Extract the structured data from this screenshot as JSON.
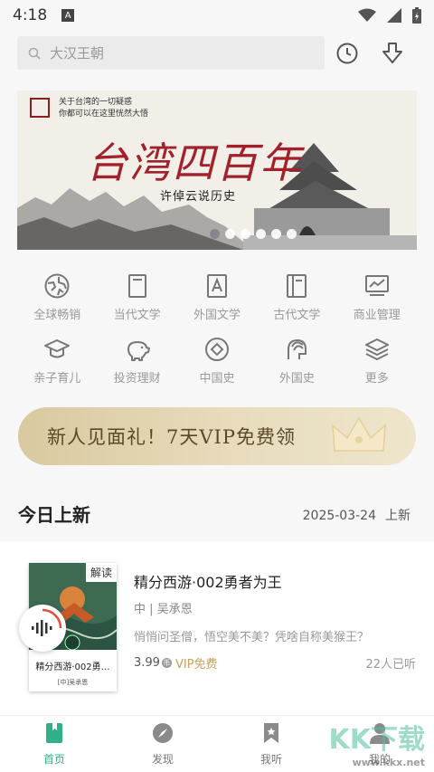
{
  "status_bar": {
    "time": "4:18",
    "sim_label": "A"
  },
  "search": {
    "placeholder": "大汉王朝"
  },
  "banner": {
    "line1": "关于台湾的一切疑惑",
    "line2": "你都可以在这里恍然大悟",
    "title": "台湾四百年",
    "subtitle": "许倬云说历史",
    "dot_count": 6,
    "active_dot": 0
  },
  "categories": [
    {
      "label": "全球畅销",
      "icon": "globe-icon"
    },
    {
      "label": "当代文学",
      "icon": "book-icon"
    },
    {
      "label": "外国文学",
      "icon": "letter-a-book-icon"
    },
    {
      "label": "古代文学",
      "icon": "scroll-book-icon"
    },
    {
      "label": "商业管理",
      "icon": "chart-monitor-icon"
    },
    {
      "label": "亲子育儿",
      "icon": "graduation-cap-icon"
    },
    {
      "label": "投资理财",
      "icon": "piggy-bank-icon"
    },
    {
      "label": "中国史",
      "icon": "ancient-coin-icon"
    },
    {
      "label": "外国史",
      "icon": "spartan-helmet-icon"
    },
    {
      "label": "更多",
      "icon": "layers-icon"
    }
  ],
  "vip_banner": {
    "text": "新人见面礼！7天VIP免费领"
  },
  "section": {
    "title": "今日上新",
    "date": "2025-03-24",
    "suffix": "上新"
  },
  "book": {
    "cover_tag": "解读",
    "cover_title": "精分西游·002勇…",
    "cover_author": "[中]吴承恩",
    "title": "精分西游·002勇者为王",
    "author": "中 | 吴承恩",
    "description": "悄悄问圣僧，悟空美不美？凭啥自称美猴王？",
    "price": "3.99",
    "coin_symbol": "币",
    "vip_label": "VIP免费",
    "listeners": "22人已听"
  },
  "nav": [
    {
      "label": "首页",
      "icon": "home-book-icon",
      "active": true
    },
    {
      "label": "发现",
      "icon": "compass-icon",
      "active": false
    },
    {
      "label": "我听",
      "icon": "bookmark-icon",
      "active": false
    },
    {
      "label": "我的",
      "icon": "user-icon",
      "active": false
    }
  ],
  "watermark": {
    "text": "KK下载",
    "url": "www.kkx.net"
  },
  "colors": {
    "accent": "#2fb088",
    "banner_red": "#a2212b",
    "vip_gold": "#c9a35c"
  }
}
